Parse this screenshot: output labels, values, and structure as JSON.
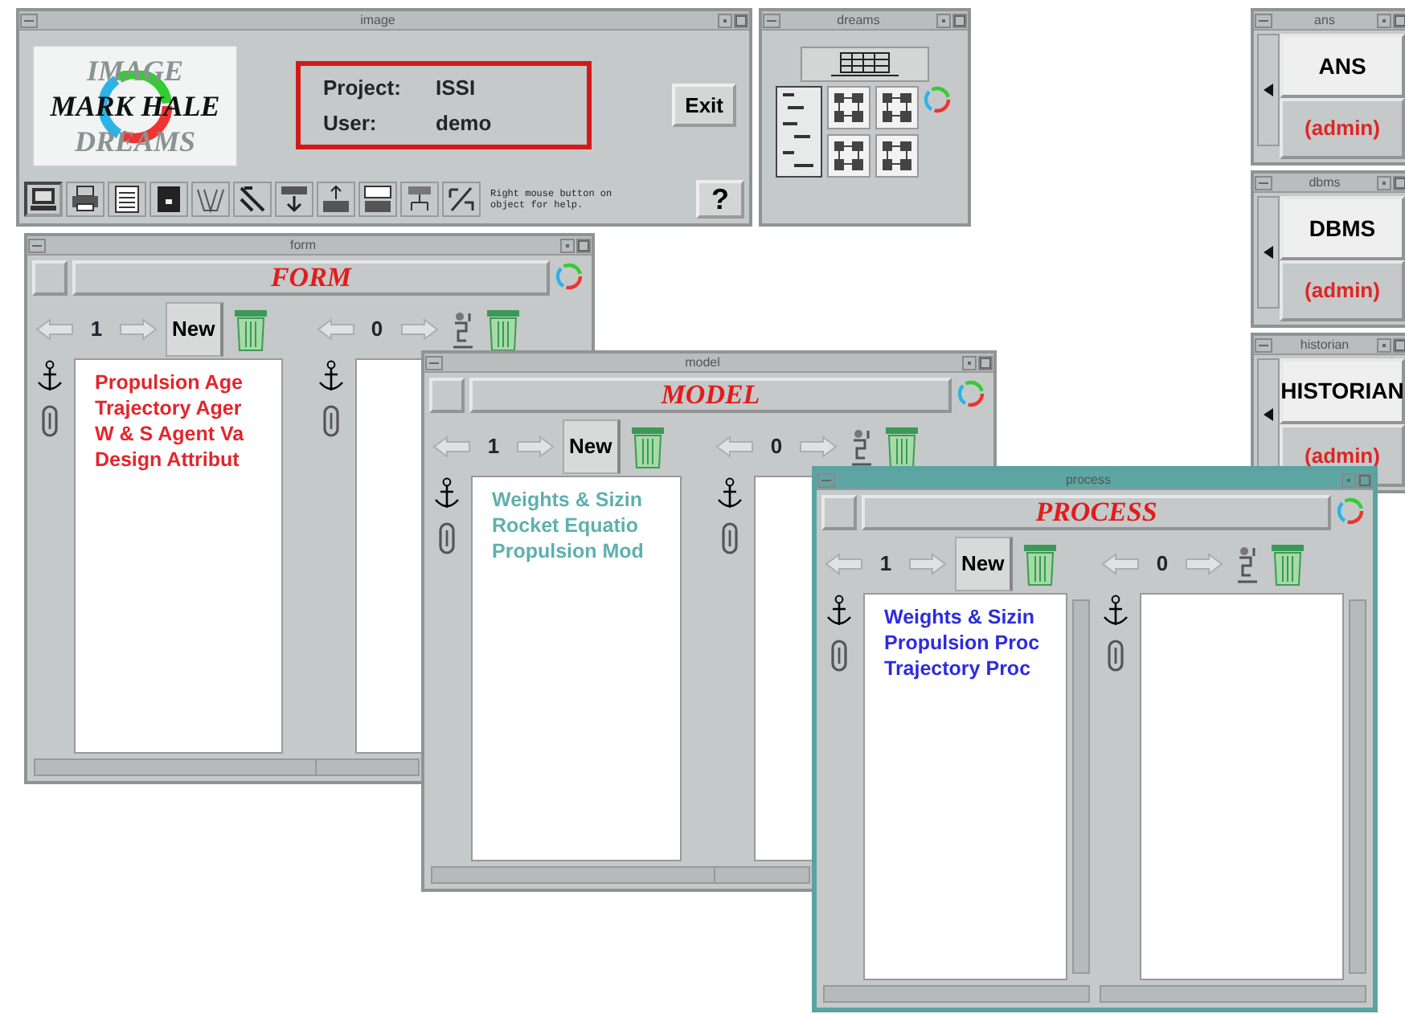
{
  "image_window": {
    "title": "image",
    "logo": {
      "top": "IMAGE",
      "name": "MARK HALE",
      "bottom": "DREAMS"
    },
    "project_label": "Project:",
    "project": "ISSI",
    "user_label": "User:",
    "user": "demo",
    "exit_button": "Exit",
    "help_hint": "Right mouse button on object for help.",
    "help_button": "?"
  },
  "dreams_window": {
    "title": "dreams"
  },
  "server_windows": [
    {
      "title": "ans",
      "name": "ANS",
      "role": "(admin)"
    },
    {
      "title": "dbms",
      "name": "DBMS",
      "role": "(admin)"
    },
    {
      "title": "historian",
      "name": "HISTORIAN",
      "role": "(admin)"
    }
  ],
  "list_windows": [
    {
      "title": "form",
      "heading": "FORM",
      "active": false,
      "color": "#e4252b",
      "panes": [
        {
          "count": "1",
          "new_button": "New",
          "items": [
            "Propulsion Age",
            "Trajectory Ager",
            "W & S Agent Va",
            "Design Attribut"
          ]
        },
        {
          "count": "0"
        }
      ]
    },
    {
      "title": "model",
      "heading": "MODEL",
      "active": false,
      "color": "#5eb0ae",
      "panes": [
        {
          "count": "1",
          "new_button": "New",
          "items": [
            "Weights & Sizin",
            "Rocket Equatio",
            "Propulsion Mod"
          ]
        },
        {
          "count": "0"
        }
      ]
    },
    {
      "title": "process",
      "heading": "PROCESS",
      "active": true,
      "color": "#2c2ce0",
      "panes": [
        {
          "count": "1",
          "new_button": "New",
          "items": [
            "Weights & Sizin",
            "Propulsion Proc",
            "Trajectory Proc"
          ]
        },
        {
          "count": "0"
        }
      ]
    }
  ]
}
